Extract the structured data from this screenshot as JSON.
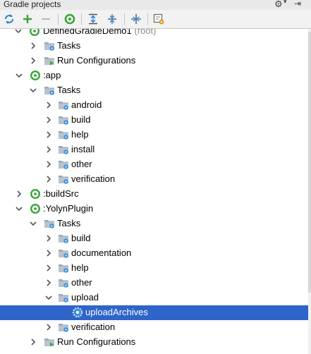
{
  "panel": {
    "title": "Gradle projects"
  },
  "header_icons": [
    "gear-icon",
    "chevron-down-icon",
    "hide-panel-icon"
  ],
  "toolbar": {
    "buttons": [
      "refresh-all-icon",
      "add-project-icon",
      "remove-project-icon",
      "execute-task-icon",
      "expand-all-icon",
      "collapse-all-icon",
      "toggle-offline-icon",
      "gradle-settings-icon"
    ]
  },
  "colors": {
    "selection": "#2f65ca",
    "folder": "#9aa7b5",
    "gear_blue": "#3d8fd8",
    "project_green": "#3aa53a"
  },
  "tree": {
    "root_project": {
      "name": "DefinedGradleDemo1",
      "suffix": "(root)"
    },
    "nodes": [
      {
        "label": "Tasks",
        "icon": "task-folder-icon",
        "state": "collapsed"
      },
      {
        "label": "Run Configurations",
        "icon": "run-config-folder-icon",
        "state": "collapsed"
      },
      {
        "label": ":app",
        "icon": "gradle-module-icon",
        "state": "expanded"
      },
      {
        "label": "Tasks",
        "icon": "task-folder-icon",
        "state": "expanded"
      },
      {
        "label": "android",
        "icon": "task-folder-icon",
        "state": "collapsed"
      },
      {
        "label": "build",
        "icon": "task-folder-icon",
        "state": "collapsed"
      },
      {
        "label": "help",
        "icon": "task-folder-icon",
        "state": "collapsed"
      },
      {
        "label": "install",
        "icon": "task-folder-icon",
        "state": "collapsed"
      },
      {
        "label": "other",
        "icon": "task-folder-icon",
        "state": "collapsed"
      },
      {
        "label": "verification",
        "icon": "task-folder-icon",
        "state": "collapsed"
      },
      {
        "label": ":buildSrc",
        "icon": "gradle-module-icon",
        "state": "collapsed"
      },
      {
        "label": ":YolynPlugin",
        "icon": "gradle-module-icon",
        "state": "expanded"
      },
      {
        "label": "Tasks",
        "icon": "task-folder-icon",
        "state": "expanded"
      },
      {
        "label": "build",
        "icon": "task-folder-icon",
        "state": "collapsed"
      },
      {
        "label": "documentation",
        "icon": "task-folder-icon",
        "state": "collapsed"
      },
      {
        "label": "help",
        "icon": "task-folder-icon",
        "state": "collapsed"
      },
      {
        "label": "other",
        "icon": "task-folder-icon",
        "state": "collapsed"
      },
      {
        "label": "upload",
        "icon": "task-folder-icon",
        "state": "expanded"
      },
      {
        "label": "uploadArchives",
        "icon": "gear-task-icon",
        "state": "leaf",
        "selected": true
      },
      {
        "label": "verification",
        "icon": "task-folder-icon",
        "state": "collapsed"
      },
      {
        "label": "Run Configurations",
        "icon": "run-config-folder-icon",
        "state": "collapsed"
      }
    ]
  }
}
